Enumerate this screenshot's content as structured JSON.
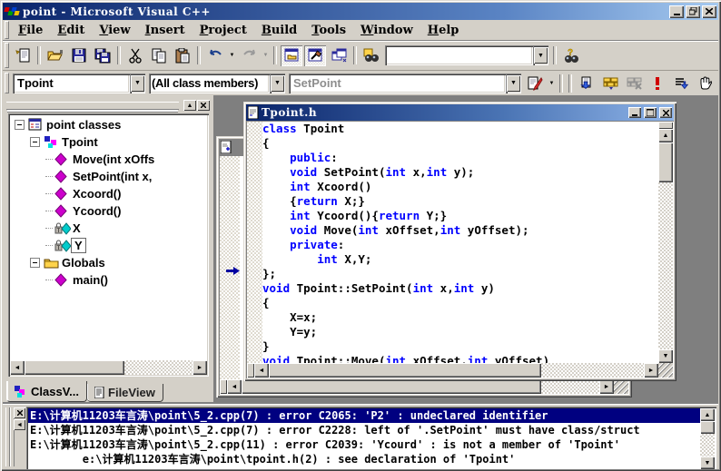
{
  "window": {
    "title": "point - Microsoft Visual C++",
    "caption_buttons": [
      "minimize",
      "restore",
      "close"
    ]
  },
  "menu_bar": {
    "items": [
      "File",
      "Edit",
      "View",
      "Insert",
      "Project",
      "Build",
      "Tools",
      "Window",
      "Help"
    ]
  },
  "toolbar": {
    "find_combo_value": "",
    "icons": [
      "new-file",
      "open",
      "save",
      "save-all",
      "cut",
      "copy",
      "paste",
      "undo",
      "redo",
      "workspace-toggle",
      "output-toggle",
      "window-list",
      "find-in-files",
      "search"
    ]
  },
  "wizard_bar": {
    "class_value": "Tpoint",
    "members_value": "(All class members)",
    "function_value": "SetPoint",
    "icons": [
      "wizardbar-actions",
      "compile",
      "build",
      "stop-build",
      "execute-program",
      "go",
      "breakpoint"
    ]
  },
  "workspace": {
    "tree": [
      {
        "depth": 0,
        "expander": "minus",
        "icon": "classview-root",
        "label": "point classes"
      },
      {
        "depth": 1,
        "expander": "minus",
        "icon": "class",
        "label": "Tpoint"
      },
      {
        "depth": 2,
        "icon": "method",
        "label": "Move(int xOffs"
      },
      {
        "depth": 2,
        "icon": "method",
        "label": "SetPoint(int x,"
      },
      {
        "depth": 2,
        "icon": "method",
        "label": "Xcoord()"
      },
      {
        "depth": 2,
        "icon": "method",
        "label": "Ycoord()"
      },
      {
        "depth": 2,
        "icon": "member-private",
        "label": "X"
      },
      {
        "depth": 2,
        "icon": "member-private",
        "label": "Y",
        "selected": true
      },
      {
        "depth": 1,
        "expander": "minus",
        "icon": "folder",
        "label": "Globals"
      },
      {
        "depth": 2,
        "icon": "method",
        "label": "main()"
      }
    ],
    "tabs": [
      {
        "label": "ClassV...",
        "icon": "classview-tab",
        "active": true
      },
      {
        "label": "FileView",
        "icon": "fileview-tab",
        "active": false
      }
    ]
  },
  "editor": {
    "window_title": "Tpoint.h",
    "caption_buttons": [
      "minimize",
      "maximize",
      "close"
    ],
    "code_lines": [
      [
        [
          "k",
          "class"
        ],
        [
          "p",
          " Tpoint"
        ]
      ],
      [
        [
          "p",
          "{"
        ]
      ],
      [
        [
          "p",
          "    "
        ],
        [
          "k",
          "public"
        ],
        [
          "p",
          ":"
        ]
      ],
      [
        [
          "p",
          "    "
        ],
        [
          "k",
          "void"
        ],
        [
          "p",
          " SetPoint("
        ],
        [
          "k",
          "int"
        ],
        [
          "p",
          " x,"
        ],
        [
          "k",
          "int"
        ],
        [
          "p",
          " y);"
        ]
      ],
      [
        [
          "p",
          "    "
        ],
        [
          "k",
          "int"
        ],
        [
          "p",
          " Xcoord()"
        ]
      ],
      [
        [
          "p",
          "    {"
        ],
        [
          "k",
          "return"
        ],
        [
          "p",
          " X;}"
        ]
      ],
      [
        [
          "p",
          "    "
        ],
        [
          "k",
          "int"
        ],
        [
          "p",
          " Ycoord(){"
        ],
        [
          "k",
          "return"
        ],
        [
          "p",
          " Y;}"
        ]
      ],
      [
        [
          "p",
          "    "
        ],
        [
          "k",
          "void"
        ],
        [
          "p",
          " Move("
        ],
        [
          "k",
          "int"
        ],
        [
          "p",
          " xOffset,"
        ],
        [
          "k",
          "int"
        ],
        [
          "p",
          " yOffset);"
        ]
      ],
      [
        [
          "p",
          "    "
        ],
        [
          "k",
          "private"
        ],
        [
          "p",
          ":"
        ]
      ],
      [
        [
          "p",
          "        "
        ],
        [
          "k",
          "int"
        ],
        [
          "p",
          " X,Y;"
        ]
      ],
      [
        [
          "p",
          "};"
        ]
      ],
      [
        [
          "k",
          "void"
        ],
        [
          "p",
          " Tpoint::SetPoint("
        ],
        [
          "k",
          "int"
        ],
        [
          "p",
          " x,"
        ],
        [
          "k",
          "int"
        ],
        [
          "p",
          " y)"
        ]
      ],
      [
        [
          "p",
          "{"
        ]
      ],
      [
        [
          "p",
          "    X=x;"
        ]
      ],
      [
        [
          "p",
          "    Y=y;"
        ]
      ],
      [
        [
          "p",
          "}"
        ]
      ],
      [
        [
          "k",
          "void"
        ],
        [
          "p",
          " Tpoint::Move("
        ],
        [
          "k",
          "int"
        ],
        [
          "p",
          " xOffset,"
        ],
        [
          "k",
          "int"
        ],
        [
          "p",
          " yOffset)"
        ]
      ]
    ]
  },
  "output": {
    "selected_index": 0,
    "lines": [
      "E:\\计算机11203车言涛\\point\\5_2.cpp(7) : error C2065: 'P2' : undeclared identifier",
      "E:\\计算机11203车言涛\\point\\5_2.cpp(7) : error C2228: left of '.SetPoint' must have class/struct",
      "E:\\计算机11203车言涛\\point\\5_2.cpp(11) : error C2039: 'Ycourd' : is not a member of 'Tpoint'",
      "        e:\\计算机11203车言涛\\point\\tpoint.h(2) : see declaration of 'Tpoint'"
    ]
  },
  "colors": {
    "keyword": "#0000ff",
    "selection_bg": "#000080",
    "titlebar_from": "#0a246a",
    "titlebar_to": "#a6caf0",
    "chrome": "#d4d0c8",
    "mdi_background": "#7f7f7f"
  }
}
